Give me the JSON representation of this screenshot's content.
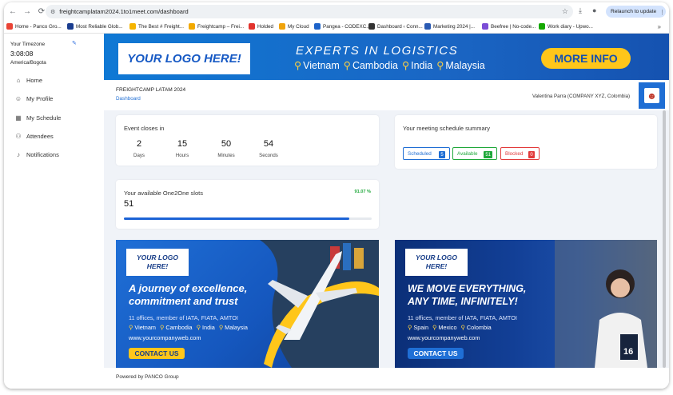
{
  "browser": {
    "url": "freightcamplatam2024.1to1meet.com/dashboard",
    "relaunch_label": "Relaunch to update",
    "bookmarks": [
      {
        "label": "Home - Panco Gro...",
        "color": "#ea4335"
      },
      {
        "label": "Most Reliable Glob...",
        "color": "#1a3d8f"
      },
      {
        "label": "The Best # Freight...",
        "color": "#f5b400"
      },
      {
        "label": "Freightcamp – Frei...",
        "color": "#f2a900"
      },
      {
        "label": "Holded",
        "color": "#e2332d"
      },
      {
        "label": "My Cloud",
        "color": "#f0a30a"
      },
      {
        "label": "Pangea - CODEXC...",
        "color": "#1d63c9"
      },
      {
        "label": "Dashboard ‹ Conn...",
        "color": "#333333"
      },
      {
        "label": "Marketing 2024 |...",
        "color": "#2a5ab3"
      },
      {
        "label": "Beefree | No-code...",
        "color": "#7b4dd6"
      },
      {
        "label": "Work diary - Upwo...",
        "color": "#14a800"
      }
    ]
  },
  "sidebar": {
    "timezone_label": "Your Timezone",
    "time": "3:08:08",
    "zone": "America/Bogota",
    "items": [
      {
        "label": "Home",
        "icon": "home-icon",
        "glyph": "⌂"
      },
      {
        "label": "My Profile",
        "icon": "user-icon",
        "glyph": "☺"
      },
      {
        "label": "My Schedule",
        "icon": "calendar-icon",
        "glyph": "▦"
      },
      {
        "label": "Attendees",
        "icon": "attendees-icon",
        "glyph": "⚇"
      },
      {
        "label": "Notifications",
        "icon": "bell-icon",
        "glyph": "♪"
      }
    ]
  },
  "banner": {
    "logo": "YOUR LOGO HERE!",
    "title": "EXPERTS IN LOGISTICS",
    "places": [
      "Vietnam",
      "Cambodia",
      "India",
      "Malaysia"
    ],
    "cta": "MORE INFO"
  },
  "header": {
    "event_title": "FREIGHTCAMP LATAM 2024",
    "breadcrumb": "Dashboard",
    "user": "Valentina Parra (COMPANY XYZ, Colombia)"
  },
  "countdown": {
    "title": "Event closes in",
    "items": [
      {
        "value": "2",
        "unit": "Days"
      },
      {
        "value": "15",
        "unit": "Hours"
      },
      {
        "value": "50",
        "unit": "Minutes"
      },
      {
        "value": "54",
        "unit": "Seconds"
      }
    ]
  },
  "schedule_summary": {
    "title": "Your meeting schedule summary",
    "chips": [
      {
        "label": "Scheduled",
        "count": "5",
        "color": "#1f6ed4"
      },
      {
        "label": "Available",
        "count": "51",
        "color": "#1fa83a"
      },
      {
        "label": "Blocked",
        "count": "0",
        "color": "#e23b3b"
      }
    ]
  },
  "slots": {
    "title": "Your available One2One slots",
    "count": "51",
    "percent_label": "91.07 %",
    "fraction": 0.9107
  },
  "ads": [
    {
      "logo": "YOUR LOGO HERE!",
      "headline": "A journey of excellence, commitment and trust",
      "offices": "11 offices, member of IATA, FIATA, AMTOI",
      "places": [
        "Vietnam",
        "Cambodia",
        "India",
        "Malaysia"
      ],
      "web": "www.yourcompanyweb.com",
      "cta": "CONTACT US"
    },
    {
      "logo": "YOUR LOGO HERE!",
      "headline": "WE MOVE EVERYTHING, ANY TIME, INFINITELY!",
      "offices": "11 offices, member of IATA, FIATA, AMTOI",
      "places": [
        "Spain",
        "Mexico",
        "Colombia"
      ],
      "web": "www.yourcompanyweb.com",
      "cta": "CONTACT US"
    }
  ],
  "footer": {
    "text": "Powered by PANCO Group"
  }
}
